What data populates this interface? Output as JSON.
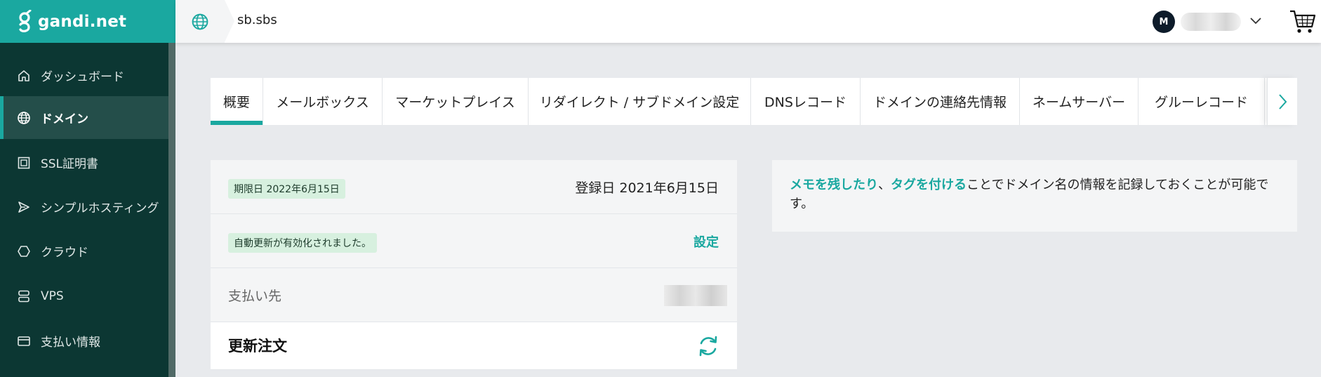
{
  "brand": {
    "name": "gandi.net",
    "accent": "#1aa8a0",
    "sidebar_bg": "#0c3733"
  },
  "sidebar": {
    "items": [
      {
        "label": "ダッシュボード",
        "icon": "home-icon"
      },
      {
        "label": "ドメイン",
        "icon": "globe-icon",
        "active": true
      },
      {
        "label": "SSL証明書",
        "icon": "certificate-icon"
      },
      {
        "label": "シンプルホスティング",
        "icon": "send-icon"
      },
      {
        "label": "クラウド",
        "icon": "cloud-hexagon-icon"
      },
      {
        "label": "VPS",
        "icon": "server-icon"
      },
      {
        "label": "支払い情報",
        "icon": "credit-card-icon"
      }
    ]
  },
  "header": {
    "domain": "sb.sbs",
    "avatar_initial": "M"
  },
  "tabs": [
    {
      "label": "概要",
      "active": true
    },
    {
      "label": "メールボックス"
    },
    {
      "label": "マーケットプレイス"
    },
    {
      "label": "リダイレクト / サブドメイン設定"
    },
    {
      "label": "DNSレコード"
    },
    {
      "label": "ドメインの連絡先情報"
    },
    {
      "label": "ネームサーバー"
    },
    {
      "label": "グルーレコード"
    }
  ],
  "overview": {
    "expiry_badge": "期限日 2022年6月15日",
    "registration": "登録日 2021年6月15日",
    "autorenew_badge": "自動更新が有効化されました。",
    "settings_link": "設定",
    "payment_label": "支払い先",
    "renew_title": "更新注文"
  },
  "note": {
    "link_memo": "メモを残したり",
    "separator": "、",
    "link_tag": "タグを付ける",
    "rest": "ことでドメイン名の情報を記録しておくことが可能です。"
  }
}
